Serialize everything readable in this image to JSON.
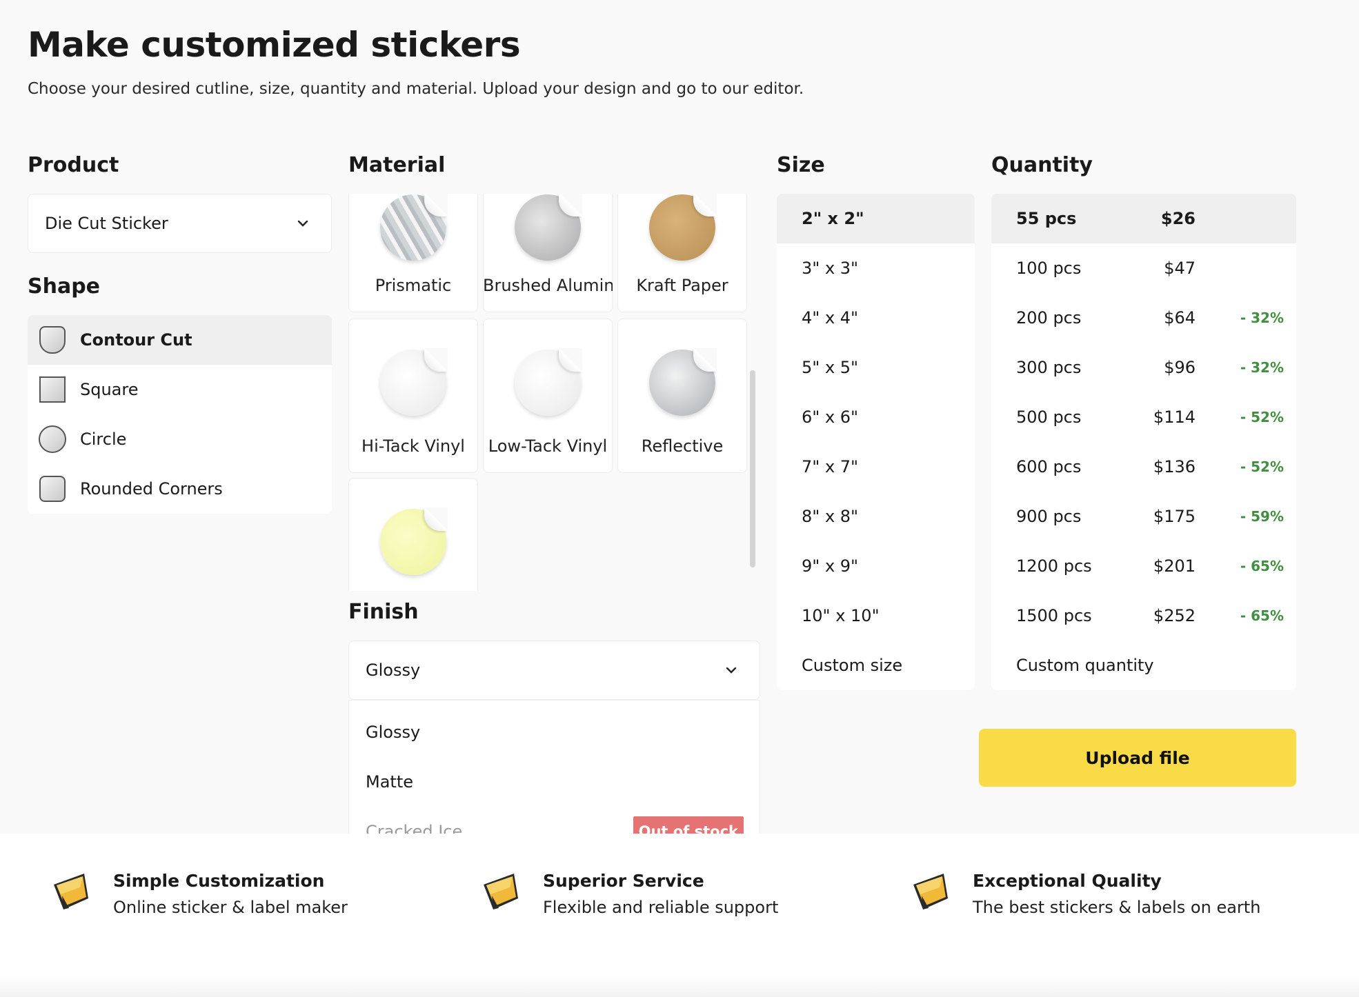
{
  "header": {
    "title": "Make customized stickers",
    "subtitle": "Choose your desired cutline, size, quantity and material. Upload your design and go to our editor."
  },
  "product": {
    "heading": "Product",
    "selected": "Die Cut Sticker"
  },
  "shape": {
    "heading": "Shape",
    "items": [
      {
        "label": "Contour Cut",
        "icon": "contour-cut-icon",
        "selected": true
      },
      {
        "label": "Square",
        "icon": "square-icon"
      },
      {
        "label": "Circle",
        "icon": "circle-icon"
      },
      {
        "label": "Rounded Corners",
        "icon": "rounded-corners-icon"
      }
    ]
  },
  "material": {
    "heading": "Material",
    "items": [
      {
        "label": "Prismatic",
        "icon": "prismatic-sticker-icon"
      },
      {
        "label": "Brushed Aluminum",
        "icon": "brushed-aluminum-sticker-icon"
      },
      {
        "label": "Kraft Paper",
        "icon": "kraft-paper-sticker-icon"
      },
      {
        "label": "Hi-Tack Vinyl",
        "icon": "hi-tack-vinyl-sticker-icon"
      },
      {
        "label": "Low-Tack Vinyl",
        "icon": "low-tack-vinyl-sticker-icon"
      },
      {
        "label": "Reflective",
        "icon": "reflective-sticker-icon"
      },
      {
        "label": "",
        "icon": "yellow-sticker-icon"
      }
    ]
  },
  "finish": {
    "heading": "Finish",
    "selected": "Glossy",
    "options": [
      {
        "label": "Glossy"
      },
      {
        "label": "Matte"
      },
      {
        "label": "Cracked Ice",
        "disabled": true,
        "badge": "Out of stock"
      }
    ]
  },
  "size": {
    "heading": "Size",
    "items": [
      {
        "label": "2\" x 2\"",
        "selected": true
      },
      {
        "label": "3\" x 3\""
      },
      {
        "label": "4\" x 4\""
      },
      {
        "label": "5\" x 5\""
      },
      {
        "label": "6\" x 6\""
      },
      {
        "label": "7\" x 7\""
      },
      {
        "label": "8\" x 8\""
      },
      {
        "label": "9\" x 9\""
      },
      {
        "label": "10\" x 10\""
      },
      {
        "label": "Custom size"
      }
    ]
  },
  "quantity": {
    "heading": "Quantity",
    "items": [
      {
        "pcs": "55 pcs",
        "price": "$26",
        "discount": "",
        "selected": true
      },
      {
        "pcs": "100 pcs",
        "price": "$47",
        "discount": ""
      },
      {
        "pcs": "200 pcs",
        "price": "$64",
        "discount": "- 32%"
      },
      {
        "pcs": "300 pcs",
        "price": "$96",
        "discount": "- 32%"
      },
      {
        "pcs": "500 pcs",
        "price": "$114",
        "discount": "- 52%"
      },
      {
        "pcs": "600 pcs",
        "price": "$136",
        "discount": "- 52%"
      },
      {
        "pcs": "900 pcs",
        "price": "$175",
        "discount": "- 59%"
      },
      {
        "pcs": "1200 pcs",
        "price": "$201",
        "discount": "- 65%"
      },
      {
        "pcs": "1500 pcs",
        "price": "$252",
        "discount": "- 65%"
      },
      {
        "pcs": "Custom quantity",
        "price": "",
        "discount": ""
      }
    ],
    "upload_label": "Upload file"
  },
  "features": [
    {
      "title": "Simple Customization",
      "desc": "Online sticker & label maker",
      "icon": "sticker-pencil-icon"
    },
    {
      "title": "Superior Service",
      "desc": "Flexible and reliable support",
      "icon": "sticker-pencil-icon"
    },
    {
      "title": "Exceptional Quality",
      "desc": "The best stickers & labels on earth",
      "icon": "sticker-pencil-icon"
    }
  ],
  "colors": {
    "accent_yellow": "#f8db46",
    "discount_green": "#3f8f3f",
    "out_of_stock_red": "#e57373",
    "selected_row": "#efefef"
  }
}
